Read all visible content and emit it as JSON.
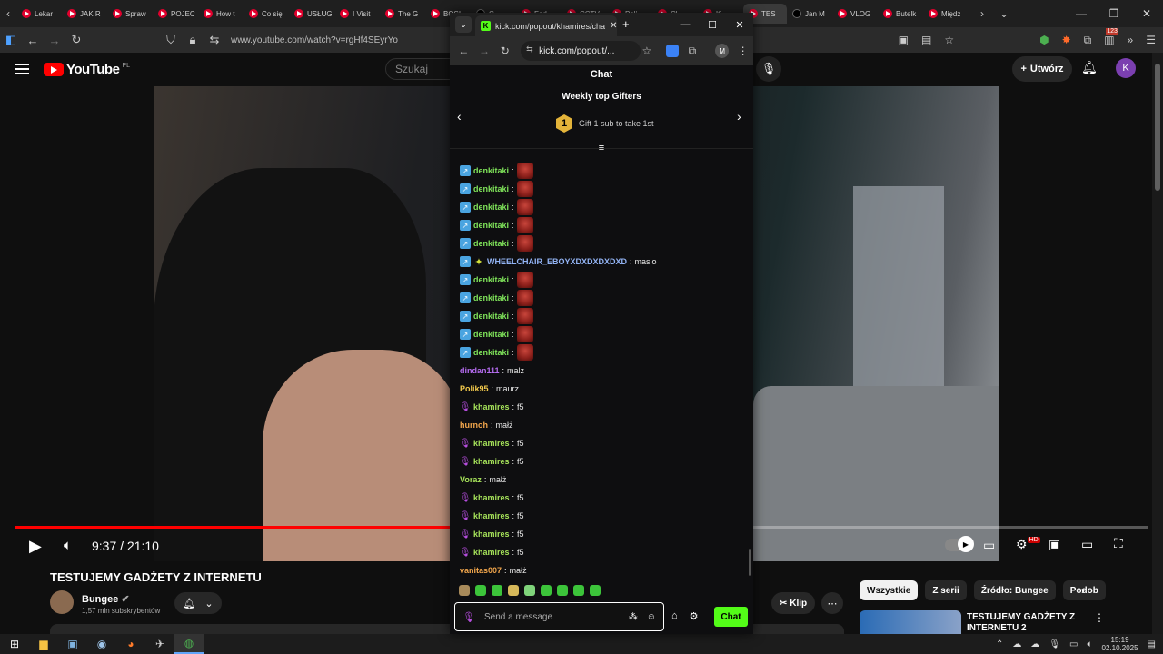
{
  "browser": {
    "tabs": [
      {
        "label": "Lekar"
      },
      {
        "label": "JAK R"
      },
      {
        "label": "Spraw"
      },
      {
        "label": "POJEC"
      },
      {
        "label": "How t"
      },
      {
        "label": "Co się"
      },
      {
        "label": "USŁUG"
      },
      {
        "label": "I Visit"
      },
      {
        "label": "The G"
      },
      {
        "label": "BOSI"
      },
      {
        "label": "G"
      },
      {
        "label": "Fod"
      },
      {
        "label": "CCTV"
      },
      {
        "label": "Poli"
      },
      {
        "label": "Cl"
      },
      {
        "label": "K"
      },
      {
        "label": "TES"
      },
      {
        "label": "Jan M"
      },
      {
        "label": "VLOG"
      },
      {
        "label": "Butelk"
      },
      {
        "label": "Międz"
      }
    ],
    "url": "www.youtube.com/watch?v=rgHf4SEyrYo",
    "ext_badge": "123"
  },
  "youtube": {
    "logo_text": "YouTube",
    "logo_country": "PL",
    "search_placeholder": "Szukaj",
    "create_label": "Utwórz",
    "avatar_letter": "K",
    "video": {
      "current_time": "9:37",
      "separator": "/",
      "duration": "21:10",
      "progress_fraction": 0.4543,
      "title": "TESTUJEMY GADŻETY Z INTERNETU",
      "hd_badge": "HD"
    },
    "channel": {
      "name": "Bungee",
      "subscribers": "1,57 mln subskrybentów"
    },
    "actions": {
      "clip_label": "Klip"
    },
    "chips": [
      "Wszystkie",
      "Z serii",
      "Źródło: Bungee",
      "Podob"
    ],
    "recommended": {
      "title": "TESTUJEMY GADŻETY Z INTERNETU 2"
    }
  },
  "taskbar": {
    "time": "15:19",
    "date": "02.10.2025"
  },
  "kick": {
    "tab_title": "kick.com/popout/khamires/cha",
    "url": "kick.com/popout/...",
    "avatar_letter": "M",
    "header": "Chat",
    "gifters_title": "Weekly top Gifters",
    "gift_rank": "1",
    "gift_text": "Gift 1 sub to take 1st",
    "messages": [
      {
        "user": "denkitaki",
        "sep": ":",
        "text": "",
        "color": "#7fe35a",
        "badges": [
          "verified"
        ],
        "emote": true
      },
      {
        "user": "denkitaki",
        "sep": ":",
        "text": "",
        "color": "#7fe35a",
        "badges": [
          "verified"
        ],
        "emote": true
      },
      {
        "user": "denkitaki",
        "sep": ":",
        "text": "",
        "color": "#7fe35a",
        "badges": [
          "verified"
        ],
        "emote": true
      },
      {
        "user": "denkitaki",
        "sep": ":",
        "text": "",
        "color": "#7fe35a",
        "badges": [
          "verified"
        ],
        "emote": true
      },
      {
        "user": "denkitaki",
        "sep": ":",
        "text": "",
        "color": "#7fe35a",
        "badges": [
          "verified"
        ],
        "emote": true
      },
      {
        "user": "WHEELCHAIR_EBOYXDXDXDXDXD",
        "sep": ":",
        "text": "maslo",
        "color": "#93b4f5",
        "badges": [
          "verified",
          "star"
        ],
        "emote": false
      },
      {
        "user": "denkitaki",
        "sep": ":",
        "text": "",
        "color": "#7fe35a",
        "badges": [
          "verified"
        ],
        "emote": true
      },
      {
        "user": "denkitaki",
        "sep": ":",
        "text": "",
        "color": "#7fe35a",
        "badges": [
          "verified"
        ],
        "emote": true
      },
      {
        "user": "denkitaki",
        "sep": ":",
        "text": "",
        "color": "#7fe35a",
        "badges": [
          "verified"
        ],
        "emote": true
      },
      {
        "user": "denkitaki",
        "sep": ":",
        "text": "",
        "color": "#7fe35a",
        "badges": [
          "verified"
        ],
        "emote": true
      },
      {
        "user": "denkitaki",
        "sep": ":",
        "text": "",
        "color": "#7fe35a",
        "badges": [
          "verified"
        ],
        "emote": true
      },
      {
        "user": "dindan111",
        "sep": ":",
        "text": "malz",
        "color": "#b56cf0",
        "badges": [],
        "emote": false
      },
      {
        "user": "Polik95",
        "sep": ":",
        "text": "maurz",
        "color": "#f2c94c",
        "badges": [],
        "emote": false
      },
      {
        "user": "khamires",
        "sep": ":",
        "text": "f5",
        "color": "#a6e35a",
        "badges": [
          "mic"
        ],
        "emote": false
      },
      {
        "user": "hurnoh",
        "sep": ":",
        "text": "małż",
        "color": "#f2a64c",
        "badges": [],
        "emote": false
      },
      {
        "user": "khamires",
        "sep": ":",
        "text": "f5",
        "color": "#a6e35a",
        "badges": [
          "mic"
        ],
        "emote": false
      },
      {
        "user": "khamires",
        "sep": ":",
        "text": "f5",
        "color": "#a6e35a",
        "badges": [
          "mic"
        ],
        "emote": false
      },
      {
        "user": "Voraz",
        "sep": ":",
        "text": "małż",
        "color": "#a6e35a",
        "badges": [],
        "emote": false
      },
      {
        "user": "khamires",
        "sep": ":",
        "text": "f5",
        "color": "#a6e35a",
        "badges": [
          "mic"
        ],
        "emote": false
      },
      {
        "user": "khamires",
        "sep": ":",
        "text": "f5",
        "color": "#a6e35a",
        "badges": [
          "mic"
        ],
        "emote": false
      },
      {
        "user": "khamires",
        "sep": ":",
        "text": "f5",
        "color": "#a6e35a",
        "badges": [
          "mic"
        ],
        "emote": false
      },
      {
        "user": "khamires",
        "sep": ":",
        "text": "f5",
        "color": "#a6e35a",
        "badges": [
          "mic"
        ],
        "emote": false
      },
      {
        "user": "vanitas007",
        "sep": ":",
        "text": "małż",
        "color": "#f2a64c",
        "badges": [],
        "emote": false
      }
    ],
    "input_placeholder": "Send a message",
    "send_label": "Chat",
    "accent_color": "#53fc18"
  }
}
